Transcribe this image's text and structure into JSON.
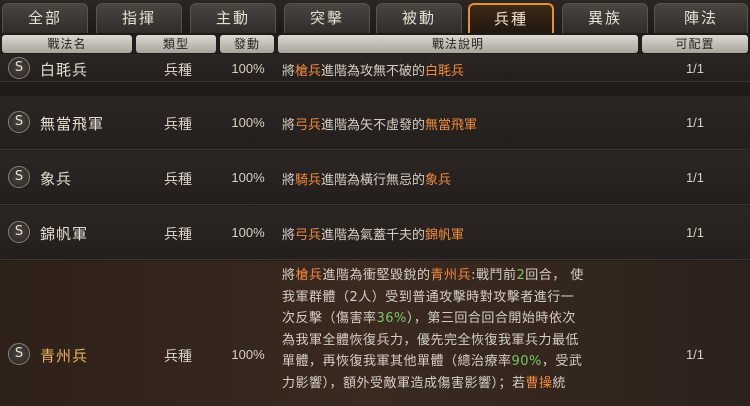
{
  "tabs": [
    {
      "label": "全部"
    },
    {
      "label": "指揮"
    },
    {
      "label": "主動"
    },
    {
      "label": "突擊"
    },
    {
      "label": "被動"
    },
    {
      "label": "兵種"
    },
    {
      "label": "異族"
    },
    {
      "label": "陣法"
    }
  ],
  "active_tab": "兵種",
  "header": {
    "name": "戰法名",
    "type": "類型",
    "rate": "發動",
    "desc": "戰法說明",
    "level": "可配置"
  },
  "rows": [
    {
      "badge": "S",
      "name": "白毦兵",
      "type": "兵種",
      "rate": "100%",
      "desc_a": "將",
      "desc_b": "槍兵",
      "desc_c": "進階為攻無不破的",
      "desc_d": "白毦兵",
      "level": "1/1"
    },
    {
      "badge": "S",
      "name": "無當飛軍",
      "type": "兵種",
      "rate": "100%",
      "desc_a": "將",
      "desc_b": "弓兵",
      "desc_c": "進階為矢不虛發的",
      "desc_d": "無當飛軍",
      "level": "1/1"
    },
    {
      "badge": "S",
      "name": "象兵",
      "type": "兵種",
      "rate": "100%",
      "desc_a": "將",
      "desc_b": "騎兵",
      "desc_c": "進階為橫行無忌的",
      "desc_d": "象兵",
      "level": "1/1"
    },
    {
      "badge": "S",
      "name": "錦帆軍",
      "type": "兵種",
      "rate": "100%",
      "desc_a": "將",
      "desc_b": "弓兵",
      "desc_c": "進階為氣蓋千夫的",
      "desc_d": "錦帆軍",
      "level": "1/1"
    }
  ],
  "selected_row": {
    "badge": "S",
    "name": "青州兵",
    "type": "兵種",
    "rate": "100%",
    "level": "1/1",
    "l1a": "將",
    "l1b": "槍兵",
    "l1c": "進階為衝堅毀銳的",
    "l1d": "青州兵",
    "l1e": ":戰鬥前",
    "l1f": "2",
    "l1g": "回合， 使",
    "l2": "我軍群體（2人）受到普通攻擊時對攻擊者進行一",
    "l3a": "次反擊（傷害率",
    "l3b": "36%",
    "l3c": "），第三回合回合開始時依次",
    "l4": "為我軍全體恢復兵力，優先完全恢復我軍兵力最低",
    "l5a": "單體，再恢復我軍其他單體（總治療率",
    "l5b": "90%",
    "l5c": "，受武",
    "l6a": "力影響），額外受敵軍造成傷害影響）；若",
    "l6b": "曹操",
    "l6c": "統"
  }
}
